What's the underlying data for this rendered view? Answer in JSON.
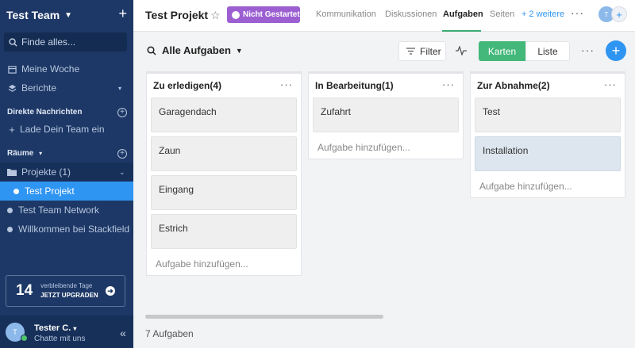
{
  "sidebar": {
    "team_name": "Test Team",
    "search_placeholder": "Finde alles...",
    "nav": {
      "my_week": "Meine Woche",
      "reports": "Berichte"
    },
    "direct_messages_title": "Direkte Nachrichten",
    "invite_team": "Lade Dein Team ein",
    "rooms_title": "Räume",
    "projects_group": "Projekte (1)",
    "active_project": "Test Projekt",
    "channels": [
      "Test Team Network",
      "Willkommen bei Stackfield"
    ],
    "upgrade": {
      "days": "14",
      "line1": "verbleibende Tage",
      "line2": "JETZT UPGRADEN"
    },
    "user": {
      "initial": "T",
      "name": "Tester C.",
      "subtitle": "Chatte mit uns"
    }
  },
  "topbar": {
    "project_title": "Test Projekt",
    "status_badge": "Nicht Gestartet",
    "tabs": [
      "Kommunikation",
      "Diskussionen",
      "Aufgaben",
      "Seiten"
    ],
    "active_tab": "Aufgaben",
    "more_tabs": "+ 2 weitere",
    "avatar_initial": "T"
  },
  "toolbar": {
    "view_title": "Alle Aufgaben",
    "filter_label": "Filter",
    "cards_label": "Karten",
    "list_label": "Liste"
  },
  "columns": [
    {
      "title": "Zu erledigen(4)",
      "cards": [
        "Garagendach",
        "Zaun",
        "Eingang",
        "Estrich"
      ],
      "add_label": "Aufgabe hinzufügen..."
    },
    {
      "title": "In Bearbeitung(1)",
      "cards": [
        "Zufahrt"
      ],
      "add_label": "Aufgabe hinzufügen..."
    },
    {
      "title": "Zur Abnahme(2)",
      "cards": [
        "Test",
        "Installation"
      ],
      "add_label": "Aufgabe hinzufügen..."
    }
  ],
  "footer": {
    "task_count": "7 Aufgaben"
  },
  "colors": {
    "sidebar_bg": "#1d3866",
    "accent_blue": "#2f95f2",
    "status_purple": "#9b5fd1",
    "active_green": "#44b87a"
  }
}
